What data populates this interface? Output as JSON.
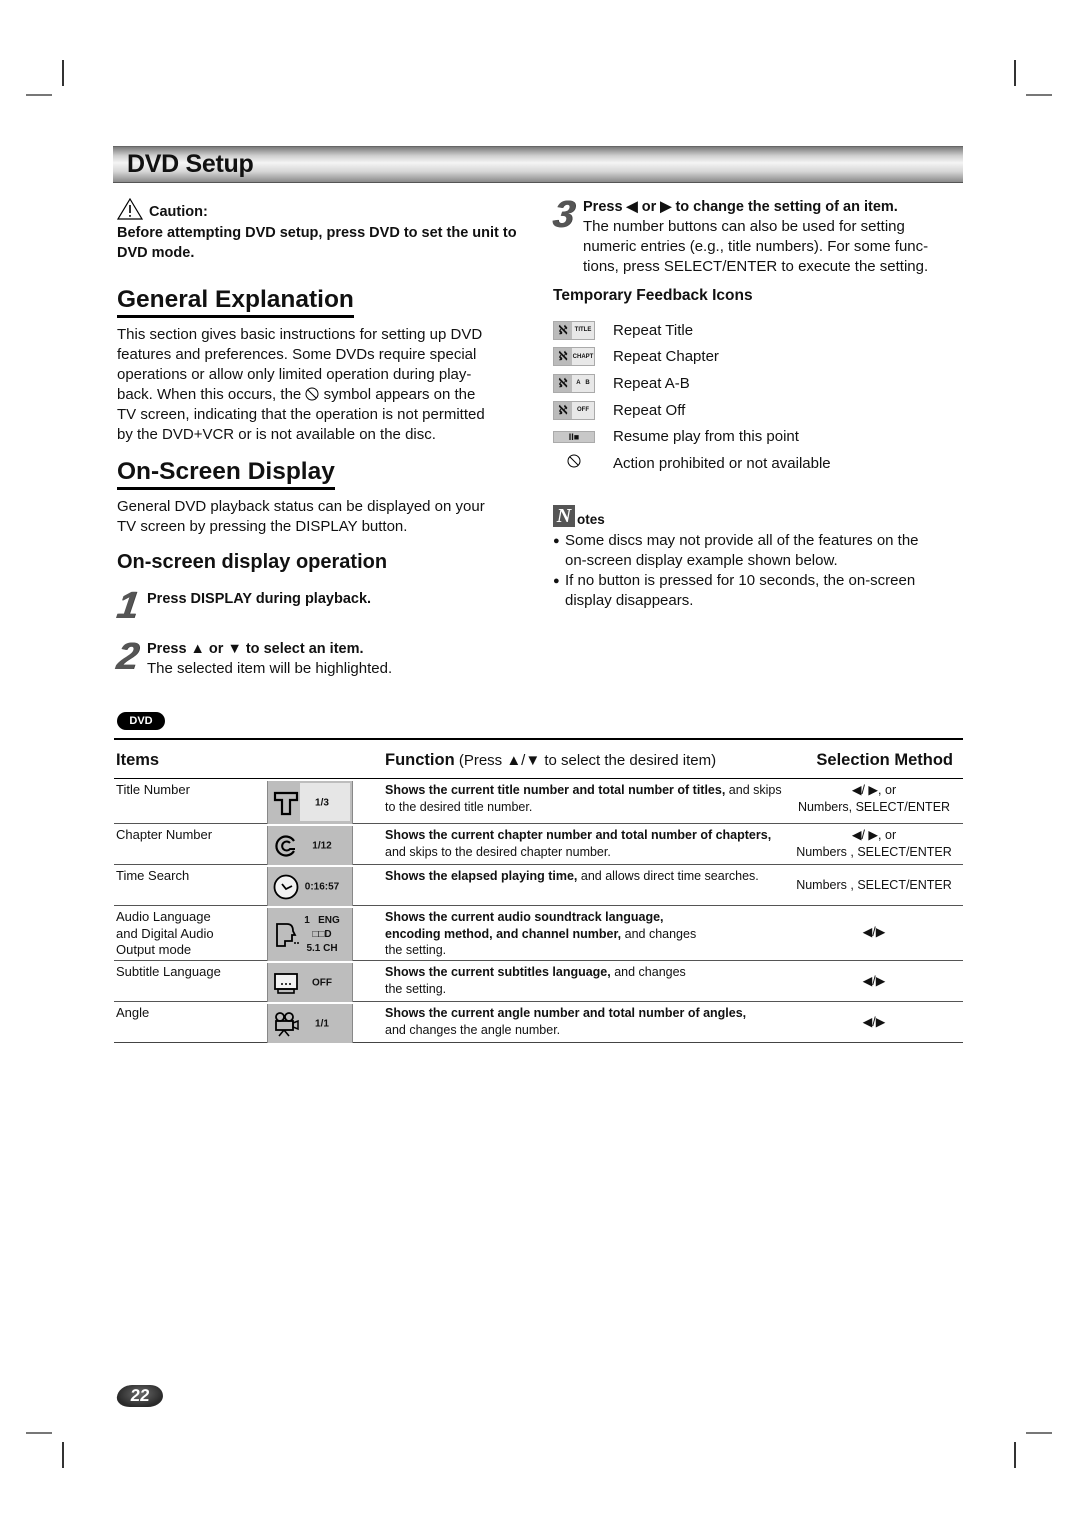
{
  "header": {
    "title": "DVD Setup"
  },
  "caution": {
    "label": "Caution:",
    "text": "Before attempting DVD setup, press DVD to set the unit to DVD mode."
  },
  "general_explanation": {
    "heading": "General Explanation",
    "lines": [
      "This section gives basic instructions for setting up DVD",
      "features and preferences. Some DVDs require special",
      "operations or allow only limited operation during play-",
      "back. When this occurs, the ",
      " symbol appears on the",
      "TV screen, indicating that the operation is not permitted",
      "by the DVD+VCR or is not available on the disc."
    ]
  },
  "on_screen_display": {
    "heading": "On-Screen Display",
    "lines": [
      "General DVD playback status can be displayed on your",
      "TV screen by pressing the DISPLAY button."
    ],
    "subheading": "On-screen display operation",
    "steps": [
      {
        "number": "1",
        "title": "Press DISPLAY during playback.",
        "text": ""
      },
      {
        "number": "2",
        "title_parts": [
          "Press ",
          "▲",
          " or ",
          "▼",
          " to select an item."
        ],
        "text": "The selected item will be highlighted."
      },
      {
        "number": "3",
        "title_parts": [
          "Press ",
          "◀",
          " or ",
          "▶",
          " to change the setting of an item."
        ],
        "lines": [
          "The number buttons can also be used for setting",
          "numeric entries (e.g., title numbers). For some func-",
          "tions, press SELECT/ENTER to execute the setting."
        ]
      }
    ]
  },
  "feedback_icons": {
    "heading": "Temporary Feedback Icons",
    "items": [
      {
        "icon": "repeat-title-icon",
        "badge": "TITLE",
        "label": "Repeat Title"
      },
      {
        "icon": "repeat-chapter-icon",
        "badge": "CHAPT",
        "label": "Repeat Chapter"
      },
      {
        "icon": "repeat-ab-icon",
        "badge": "A   B",
        "label": "Repeat A-B"
      },
      {
        "icon": "repeat-off-icon",
        "badge": "OFF",
        "label": "Repeat Off"
      },
      {
        "icon": "resume-icon",
        "badge": "II■",
        "label": "Resume play from this point"
      },
      {
        "icon": "prohibited-icon",
        "badge": "⃠",
        "label": "Action prohibited or not available"
      }
    ]
  },
  "notes": {
    "icon_letter": "N",
    "label": "otes",
    "items": [
      [
        "Some discs may not provide all of the features on the",
        "on-screen display example shown below."
      ],
      [
        "If no button is pressed for 10 seconds, the on-screen",
        "display disappears."
      ]
    ]
  },
  "dvd_badge": "DVD",
  "table": {
    "headers": {
      "items": "Items",
      "function_bold": "Function",
      "function_rest": " (Press ▲/▼ to select the desired item)",
      "selection": "Selection Method"
    },
    "rows": [
      {
        "item": [
          "Title Number"
        ],
        "osd_icon": "title-t-icon",
        "osd_value": [
          "1/3"
        ],
        "func_bold": "Shows the current title number and total number of titles,",
        "func_rest": " and skips to the desired title number.",
        "selection": [
          "◀/ ▶, or",
          "Numbers, SELECT/ENTER"
        ]
      },
      {
        "item": [
          "Chapter Number"
        ],
        "osd_icon": "chapter-c-icon",
        "osd_value": [
          "1/12"
        ],
        "func_bold": "Shows the current chapter number and total number of chapters,",
        "func_rest": " and skips to the desired chapter number.",
        "selection": [
          "◀/ ▶, or",
          "Numbers , SELECT/ENTER"
        ]
      },
      {
        "item": [
          "Time Search"
        ],
        "osd_icon": "clock-icon",
        "osd_value": [
          "0:16:57"
        ],
        "func_bold": "Shows the elapsed playing time,",
        "func_rest": " and allows direct time searches.",
        "selection": [
          "Numbers , SELECT/ENTER"
        ]
      },
      {
        "item": [
          "Audio Language",
          "and Digital Audio",
          "Output mode"
        ],
        "osd_icon": "audio-speaker-icon",
        "osd_value": [
          "1   ENG",
          "□□D",
          "5.1 CH"
        ],
        "func_bold": "Shows the current audio soundtrack language, encoding method, and channel number,",
        "func_rest": " and changes the setting.",
        "selection": [
          "◀/▶"
        ]
      },
      {
        "item": [
          "Subtitle Language"
        ],
        "osd_icon": "subtitle-icon",
        "osd_value": [
          "OFF"
        ],
        "func_bold": "Shows the current subtitles language,",
        "func_rest": " and changes the setting.",
        "selection": [
          "◀/▶"
        ]
      },
      {
        "item": [
          "Angle"
        ],
        "osd_icon": "camera-angle-icon",
        "osd_value": [
          "1/1"
        ],
        "func_bold": "Shows the current angle number and total number of angles,",
        "func_rest": " and changes the angle number.",
        "selection": [
          "◀/▶"
        ]
      }
    ]
  },
  "page_number": "22"
}
